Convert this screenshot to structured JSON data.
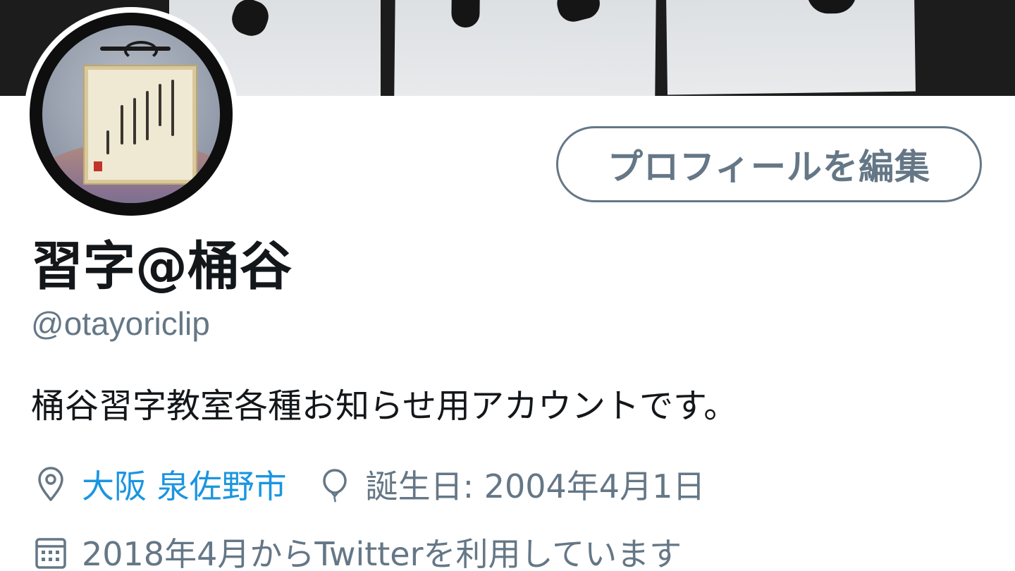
{
  "profile": {
    "edit_button_label": "プロフィールを編集",
    "display_name": "習字@桶谷",
    "handle": "@otayoriclip",
    "bio": "桶谷習字教室各種お知らせ用アカウントです。",
    "location": "大阪 泉佐野市",
    "birthday": "誕生日: 2004年4月1日",
    "joined": "2018年4月からTwitterを利用しています"
  },
  "icons": {
    "location": "location-pin-icon",
    "birthday": "balloon-icon",
    "joined": "calendar-icon"
  },
  "colors": {
    "text_primary": "#14171a",
    "text_secondary": "#657786",
    "link": "#1b95e0"
  }
}
